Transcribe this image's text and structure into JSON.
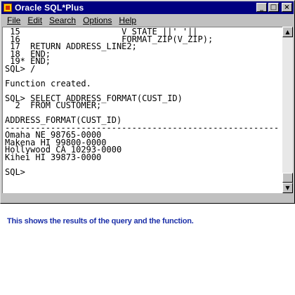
{
  "window": {
    "title": "Oracle SQL*Plus",
    "controls": {
      "minimize": "_",
      "maximize": "□",
      "close": "×"
    }
  },
  "menu": {
    "file": {
      "label": "File"
    },
    "edit": {
      "label": "Edit"
    },
    "search": {
      "label": "Search"
    },
    "options": {
      "label": "Options"
    },
    "help": {
      "label": "Help"
    }
  },
  "console": {
    "lines": [
      " 15                    V_STATE ||' '||",
      " 16                    FORMAT_ZIP(V_ZIP);",
      " 17  RETURN ADDRESS_LINE2;",
      " 18  END;",
      " 19* END;",
      "SQL> /",
      "",
      "Function created.",
      "",
      "SQL> SELECT ADDRESS_FORMAT(CUST_ID)",
      "  2  FROM CUSTOMER;",
      "",
      "ADDRESS_FORMAT(CUST_ID)",
      "------------------------------------------------------",
      "Omaha NE 98765-0000",
      "Makena HI 99800-0000",
      "Hollywood CA 10293-0000",
      "Kihei HI 39873-0000",
      "",
      "SQL>"
    ]
  },
  "scrollbar": {
    "up_arrow": "▲",
    "down_arrow": "▼"
  },
  "caption": "This shows the results of the query and the function.",
  "colors": {
    "titlebar": "#000080",
    "chrome": "#c0c0c0",
    "caption": "#1b2fa8"
  }
}
